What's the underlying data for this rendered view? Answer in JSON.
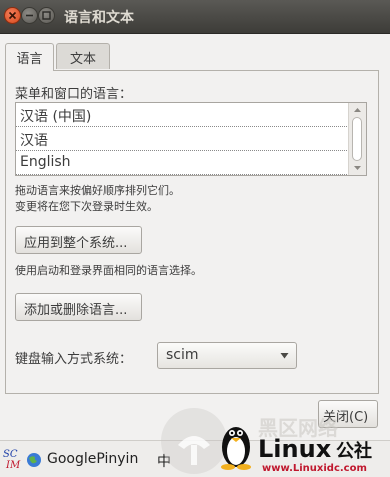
{
  "window": {
    "title": "语言和文本"
  },
  "tabs": [
    {
      "label": "语言"
    },
    {
      "label": "文本"
    }
  ],
  "language_section": {
    "label": "菜单和窗口的语言：",
    "languages": [
      "汉语 (中国)",
      "汉语",
      "English"
    ],
    "hint_line1": "拖动语言来按偏好顺序排列它们。",
    "hint_line2": "变更将在您下次登录时生效。"
  },
  "apply_system": {
    "button": "应用到整个系统...",
    "hint": "使用启动和登录界面相同的语言选择。"
  },
  "add_remove_button": "添加或删除语言...",
  "input_method": {
    "label": "键盘输入方式系统：",
    "value": "scim"
  },
  "close_button": "关闭(C)",
  "taskbar": {
    "ime_name": "GooglePinyin",
    "ime_mode": "中"
  },
  "watermark": {
    "brand": "Linux公社",
    "site": "www.Linuxidc.com"
  },
  "colors": {
    "titlebar": "#3d3c38",
    "close": "#d64a1c",
    "panel": "#f2f1f0"
  }
}
